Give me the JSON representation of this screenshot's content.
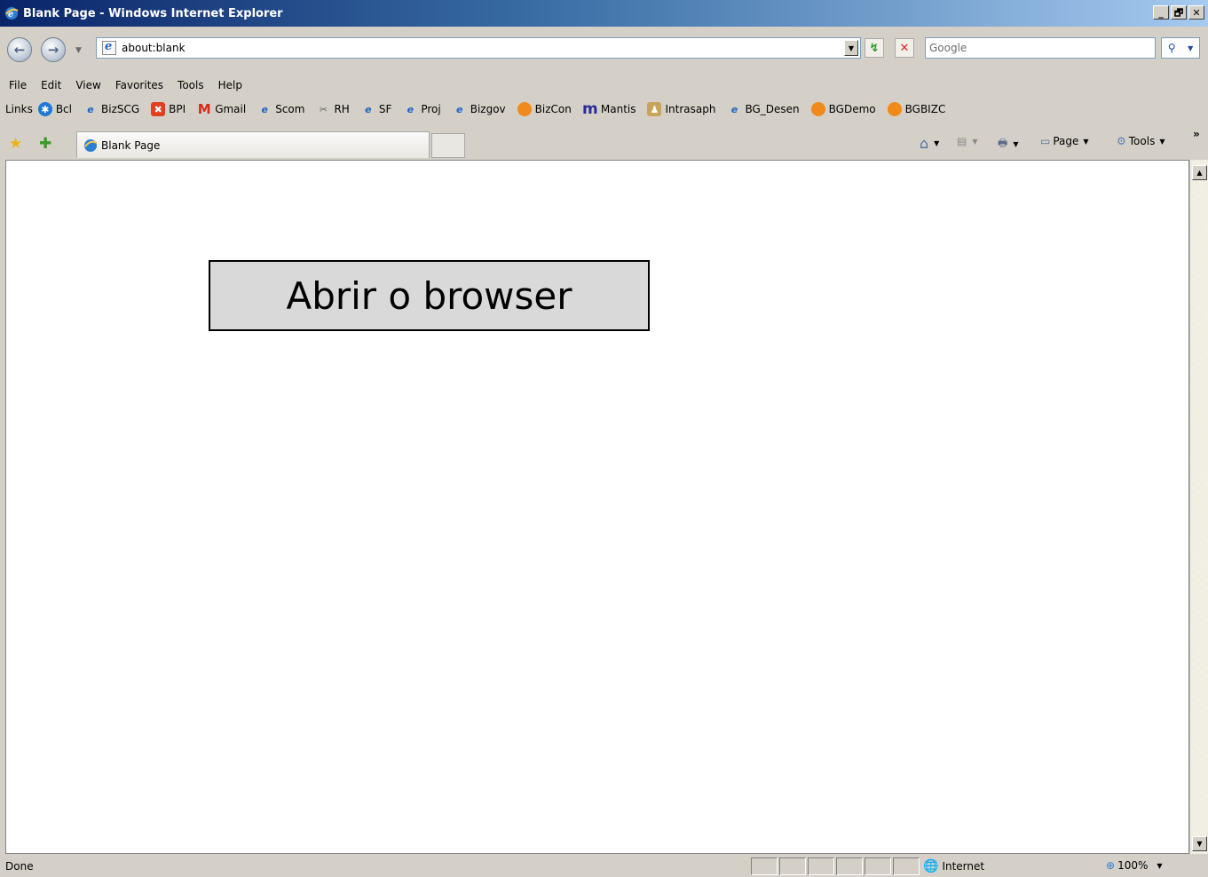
{
  "window": {
    "title": "Blank Page - Windows Internet Explorer",
    "minimize": "_",
    "maximize": "🗗",
    "close": "✕"
  },
  "address": {
    "url": "about:blank",
    "search_placeholder": "Google"
  },
  "menu": [
    "File",
    "Edit",
    "View",
    "Favorites",
    "Tools",
    "Help"
  ],
  "links": {
    "label": "Links",
    "items": [
      "Bcl",
      "BizSCG",
      "BPI",
      "Gmail",
      "Scom",
      "RH",
      "SF",
      "Proj",
      "Bizgov",
      "BizCon",
      "Mantis",
      "Intrasaph",
      "BG_Desen",
      "BGDemo",
      "BGBIZC"
    ]
  },
  "tab": {
    "title": "Blank Page"
  },
  "commands": {
    "page": "Page",
    "tools": "Tools",
    "more": "»"
  },
  "content": {
    "button_label": "Abrir o browser"
  },
  "status": {
    "text": "Done",
    "zone": "Internet",
    "zoom": "100%"
  }
}
